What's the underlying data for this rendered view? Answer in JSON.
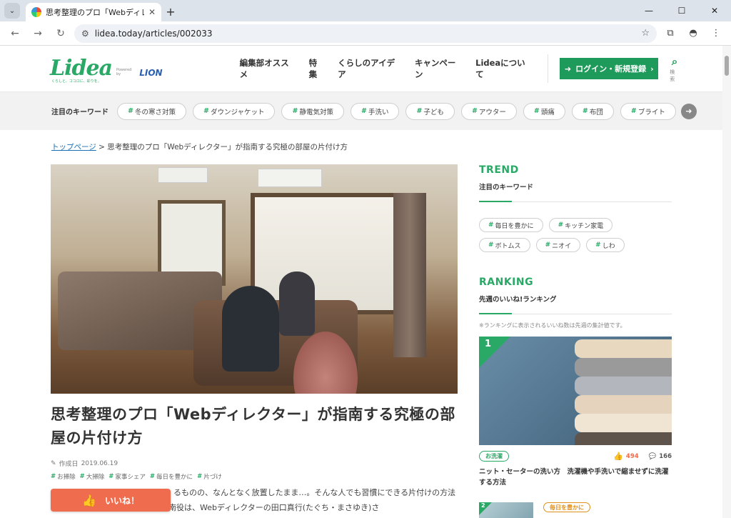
{
  "browser": {
    "tab_title": "思考整理のプロ「Webディレクター」が",
    "url": "lidea.today/articles/002033"
  },
  "header": {
    "logo_text": "Lidea",
    "logo_tagline": "くらしと、ココロに、彩りを。",
    "powered_by": "Powered by",
    "lion_text": "LION",
    "nav": [
      "編集部オススメ",
      "特集",
      "くらしのアイデア",
      "キャンペーン",
      "Lideaについて"
    ],
    "login_label": "ログイン・新規登録",
    "search_label": "検索"
  },
  "keywords": {
    "label": "注目のキーワード",
    "items": [
      "冬の寒さ対策",
      "ダウンジャケット",
      "静電気対策",
      "手洗い",
      "子ども",
      "アウター",
      "頭痛",
      "布団",
      "ブライト"
    ]
  },
  "breadcrumb": {
    "home": "トップページ",
    "separator": ">",
    "current": "思考整理のプロ「Webディレクター」が指南する究極の部屋の片付け方"
  },
  "article": {
    "title": "思考整理のプロ「Webディレクター」が指南する究極の部屋の片付け方",
    "date_label": "作成日",
    "date": "2019.06.19",
    "tags": [
      "お掃除",
      "大掃除",
      "家事シェア",
      "毎日を豊かに",
      "片づけ"
    ],
    "lead": "るものの、なんとなく放置したまま…。そんな人でも習慣にできる片付けの方法を学び、実践する企画。今回の指南役は、Webディレクターの田口真行(たぐち・まさゆき)さ",
    "like_label": "いいね！"
  },
  "sidebar": {
    "trend_heading": "TREND",
    "trend_sub": "注目のキーワード",
    "trend_tags": [
      "毎日を豊かに",
      "キッチン家電",
      "ボトムス",
      "ニオイ",
      "しわ"
    ],
    "ranking_heading": "RANKING",
    "ranking_sub": "先週のいいね!ランキング",
    "ranking_note": "※ランキングに表示されるいいね数は先週の集計値です。",
    "rank1": {
      "num": "1",
      "category": "お洗濯",
      "likes": "494",
      "comments": "166",
      "title": "ニット・セーターの洗い方　洗濯機や手洗いで縮ませずに洗濯する方法"
    },
    "rank2": {
      "num": "2",
      "category": "毎日を豊かに"
    }
  },
  "colors": {
    "brand_green": "#2aa866",
    "login_green": "#1e9a5a",
    "like_orange": "#ef6d4e",
    "link_blue": "#1a6fb5"
  }
}
